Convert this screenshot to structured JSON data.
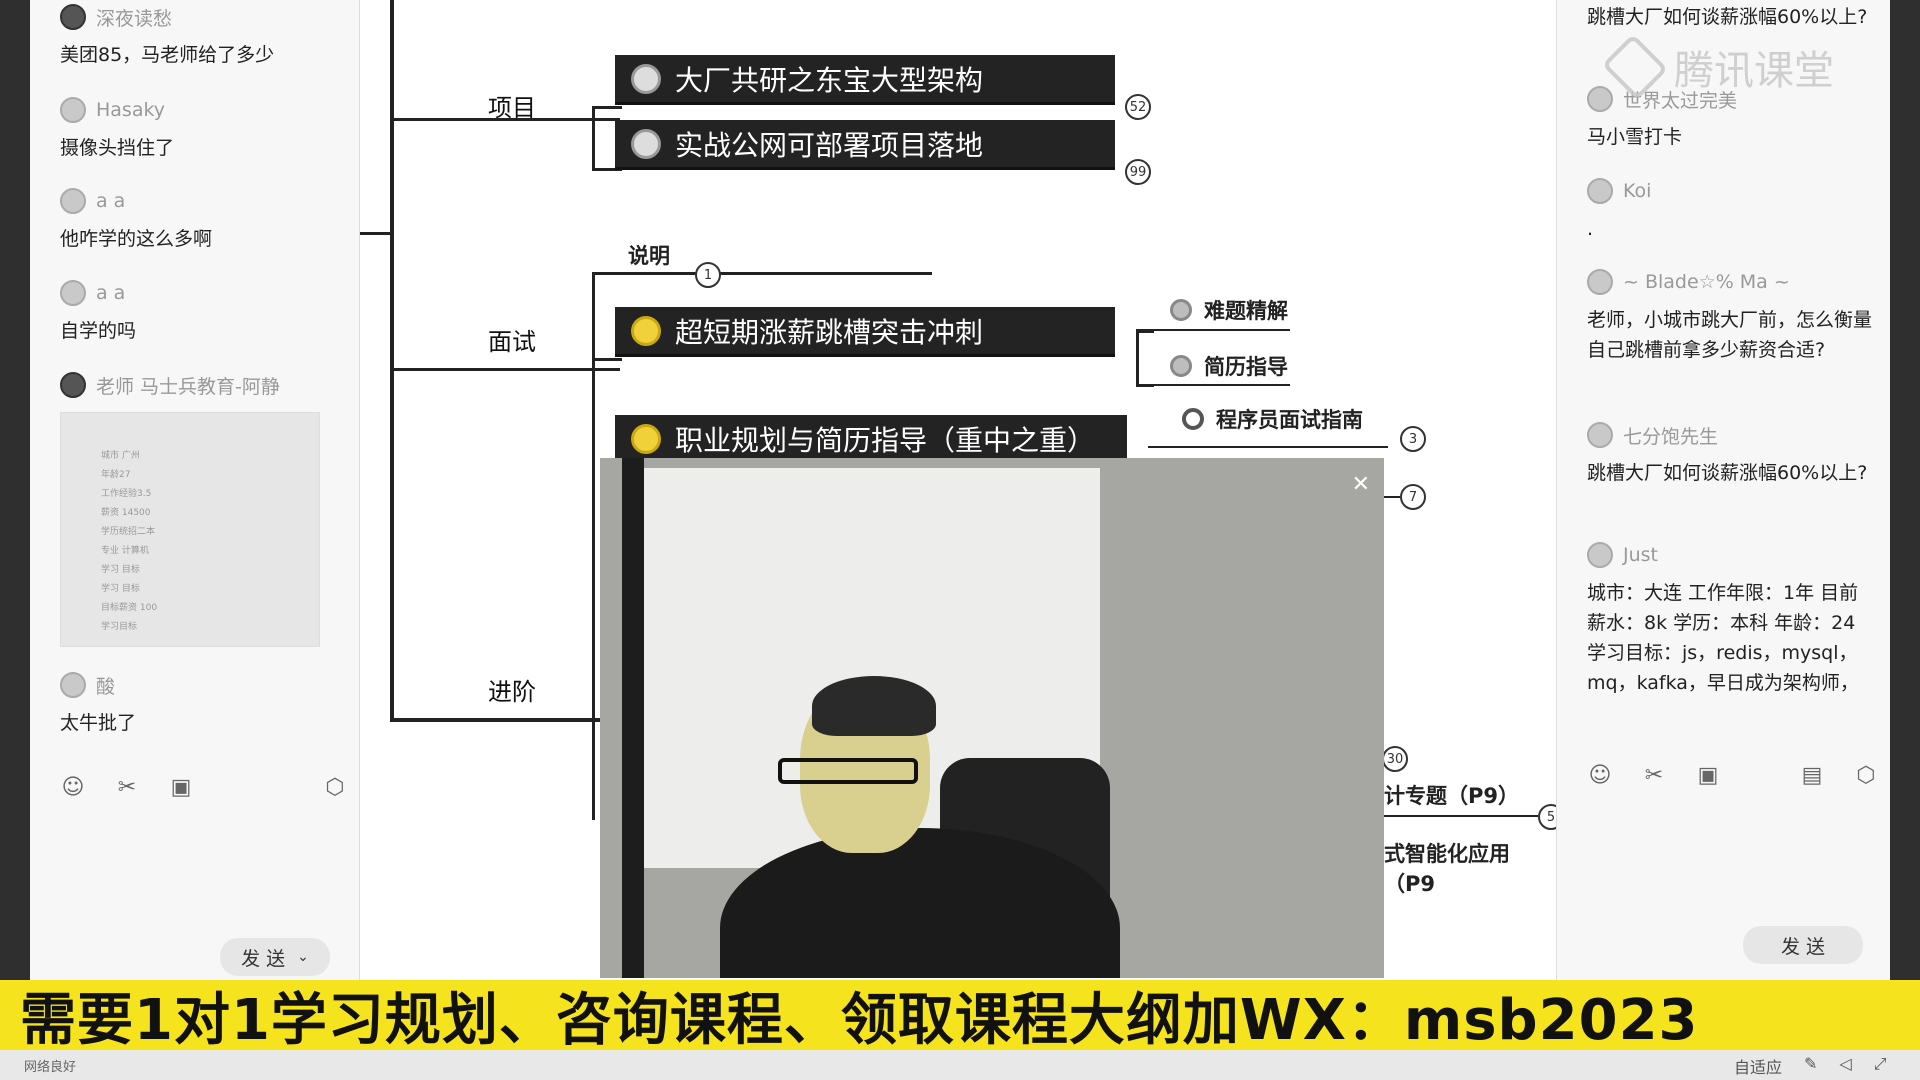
{
  "left_chat": {
    "messages": [
      {
        "user": "深夜读愁",
        "text": "美团85，马老师给了多少"
      },
      {
        "user": "Hasaky",
        "text": "摄像头挡住了"
      },
      {
        "user": "a a",
        "text": "他咋学的这么多啊"
      },
      {
        "user": "a a",
        "text": "自学的吗"
      },
      {
        "user": "老师 马士兵教育-阿静",
        "text": ""
      },
      {
        "user": "酸",
        "text": "太牛批了"
      }
    ],
    "send_label": "发 送",
    "send_dropdown": "⌄"
  },
  "right_chat": {
    "messages": [
      {
        "user": "",
        "text": "跳槽大厂如何谈薪涨幅60%以上?"
      },
      {
        "user": "世界太过完美",
        "text": "马小雪打卡"
      },
      {
        "user": "Koi",
        "text": "."
      },
      {
        "user": "~ Blade☆% Ma ~",
        "text": "老师，小城市跳大厂前，怎么衡量自己跳槽前拿多少薪资合适?"
      },
      {
        "user": "七分饱先生",
        "text": "跳槽大厂如何谈薪涨幅60%以上?"
      },
      {
        "user": "Just",
        "text": "城市：大连 工作年限：1年 目前薪水：8k 学历：本科 年龄：24 学习目标：js，redis，mysql，mq，kafka，早日成为架构师，"
      }
    ],
    "send_label": "发 送"
  },
  "watermark": "腾讯课堂",
  "mindmap": {
    "branches": {
      "project": "项目",
      "interview": "面试",
      "advanced": "进阶"
    },
    "nodes": {
      "n1": "大厂共研之东宝大型架构",
      "n2": "实战公网可部署项目落地",
      "n3": "超短期涨薪跳槽突击冲刺",
      "n4": "职业规划与简历指导（重中之重）"
    },
    "labels": {
      "explain": "说明",
      "hard": "难题精解",
      "resume": "简历指导",
      "guide": "程序员面试指南",
      "design": "计专题（P9）",
      "ai": "式智能化应用（P9"
    },
    "badges": {
      "b1": "52",
      "b2": "99",
      "b3": "1",
      "b4": "3",
      "b5": "7",
      "b6": "30",
      "b7": "5"
    }
  },
  "banner": "需要1对1学习规划、咨询课程、领取课程大纲加WX：msb2023",
  "footer": {
    "network": "网络良好",
    "fit": "自适应"
  },
  "thumb_lines": [
    "城市 广州",
    "年龄27",
    "工作经验3.5",
    "薪资 14500",
    "学历统招二本",
    "专业 计算机",
    "学习 目标",
    "学习 目标",
    "目标薪资 100",
    "学习目标"
  ]
}
